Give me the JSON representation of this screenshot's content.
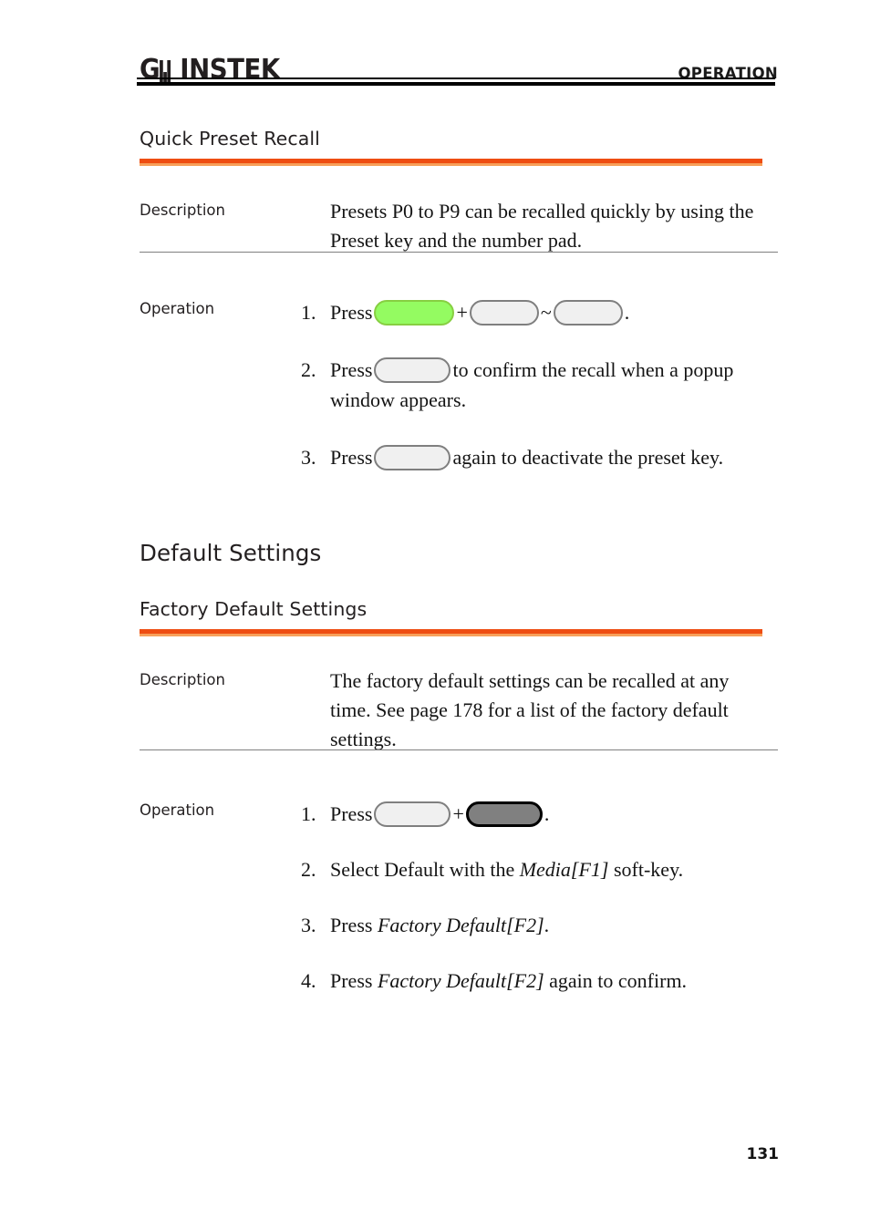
{
  "header": {
    "logo_text": "GW INSTEK",
    "logo_prefix": "G",
    "logo_suffix": "INSTEK",
    "section_title": "OPERATION"
  },
  "sections": [
    {
      "id": "quick-preset-recall",
      "heading": "Quick Preset Recall",
      "heading_level": "h2",
      "rows": [
        {
          "label": "Description",
          "text": "Presets P0 to P9 can be recalled quickly by using the Preset key and the number pad."
        },
        {
          "label": "Operation",
          "steps": [
            {
              "num": "1.",
              "parts": [
                "Press ",
                "[preset-key-green]",
                " + ",
                "[number-key-gray]",
                " ~ ",
                "[number-key-gray]",
                "."
              ],
              "prefix": "Press",
              "mid1": "+",
              "mid2": "~",
              "suffix": "."
            },
            {
              "num": "2.",
              "prefix": "Press",
              "suffix": "to confirm the recall when a popup window appears."
            },
            {
              "num": "3.",
              "prefix": "Press",
              "suffix": "again to deactivate the preset key."
            }
          ]
        }
      ]
    },
    {
      "id": "default-settings",
      "heading": "Default Settings",
      "heading_level": "h1",
      "subheading": "Factory Default Settings",
      "rows": [
        {
          "label": "Description",
          "text": "The factory default settings can be recalled at any time. See page 178 for a list of the factory default settings."
        },
        {
          "label": "Operation",
          "steps": [
            {
              "num": "1.",
              "prefix": "Press",
              "mid1": "+",
              "suffix": "."
            },
            {
              "num": "2.",
              "text_before": "Select Default with the ",
              "italic": "Media[F1]",
              "text_after": " soft-key."
            },
            {
              "num": "3.",
              "text_before": "Press ",
              "italic": "Factory Default[F2]",
              "text_after": "."
            },
            {
              "num": "4.",
              "text_before": "Press ",
              "italic": "Factory Default[F2]",
              "text_after": " again to confirm."
            }
          ]
        }
      ]
    }
  ],
  "keys": {
    "preset_green": "preset-key",
    "number_gray": "number-key",
    "enter_gray": "enter-key",
    "utility_dark": "utility-key"
  },
  "footer": {
    "page_number": "131"
  },
  "colors": {
    "rule_orange_dark": "#EE4D12",
    "rule_orange_light": "#F7A05A",
    "key_green_fill": "#94FB61",
    "key_green_border": "#87CF42",
    "key_gray_fill": "#F0F0F0",
    "key_gray_border": "#7F7F7F",
    "key_dark_fill": "#808080",
    "key_dark_border": "#000000",
    "rule_gray": "#808080"
  }
}
